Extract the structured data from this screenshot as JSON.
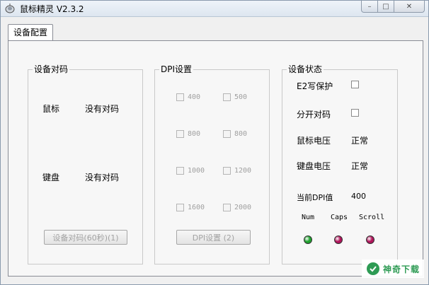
{
  "window": {
    "title": "鼠标精灵 V2.3.2",
    "controls": {
      "minimize": "–",
      "maximize": "□",
      "close": "✕"
    }
  },
  "tabs": [
    {
      "label": "设备配置",
      "active": true
    }
  ],
  "pairing_group": {
    "title": "设备对码",
    "rows": [
      {
        "device": "鼠标",
        "status": "没有对码"
      },
      {
        "device": "键盘",
        "status": "没有对码"
      }
    ],
    "button_label": "设备对码(60秒)(1)"
  },
  "dpi_group": {
    "title": "DPI设置",
    "options": [
      "400",
      "500",
      "800",
      "800",
      "1000",
      "1200",
      "1600",
      "2000"
    ],
    "button_label": "DPI设置 (2)"
  },
  "status_group": {
    "title": "设备状态",
    "e2_label": "E2写保护",
    "split_label": "分开对码",
    "mouse_voltage_label": "鼠标电压",
    "mouse_voltage_value": "正常",
    "keyboard_voltage_label": "键盘电压",
    "keyboard_voltage_value": "正常",
    "current_dpi_label": "当前DPI值",
    "current_dpi_value": "400",
    "indicators": [
      {
        "label": "Num",
        "color": "#1fa12e"
      },
      {
        "label": "Caps",
        "color": "#b0145a"
      },
      {
        "label": "Scroll",
        "color": "#b0145a"
      }
    ]
  },
  "watermark": {
    "text": "神奇下载"
  },
  "colors": {
    "led_on": "#1fa12e",
    "led_off": "#b0145a",
    "watermark": "#2e9b54"
  }
}
